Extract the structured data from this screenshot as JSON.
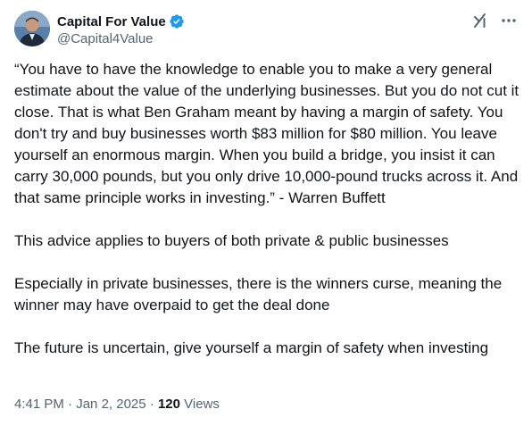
{
  "author": {
    "display_name": "Capital For Value",
    "handle": "@Capital4Value",
    "verified": true,
    "avatar": "profile-photo"
  },
  "header_actions": {
    "grok_icon": "grok-icon",
    "more_icon": "more-icon"
  },
  "tweet": {
    "paragraphs": [
      "“You have to have the knowledge to enable you to make a very general estimate about the value of the underlying businesses. But you do not cut it close. That is what Ben Graham meant by having a margin of safety. You don't try and buy businesses worth $83 million for $80 million. You leave yourself an enormous margin. When you build a bridge, you insist it can carry 30,000 pounds, but you only drive 10,000-pound trucks across it.  And that same principle works in investing.” - Warren Buffett",
      "This advice applies to buyers of both private & public businesses",
      "Especially in private businesses, there is the winners curse, meaning the winner may have overpaid to get the deal done",
      "The future is uncertain, give yourself a margin of safety when investing"
    ]
  },
  "meta": {
    "time": "4:41 PM",
    "separator": " · ",
    "date": "Jan 2, 2025",
    "views_count": "120",
    "views_label": " Views"
  },
  "colors": {
    "text": "#0f1419",
    "secondary": "#536471",
    "verified": "#1d9bf0"
  }
}
